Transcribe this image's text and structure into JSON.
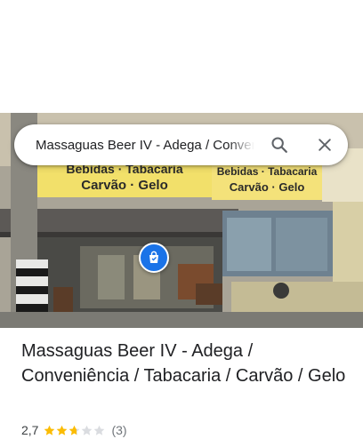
{
  "search": {
    "query": "Massaguas Beer IV - Adega / Conveniência / Tabacaria / Carvão / Gelo"
  },
  "photo": {
    "sign_left_line1": "Bebidas · Tabacaria",
    "sign_left_line2": "Carvão · Gelo",
    "sign_right_line1": "Bebidas · Tabacaria",
    "sign_right_line2": "Carvão · Gelo",
    "marker_icon": "shopping-bag-icon",
    "marker_color": "#1a73e8"
  },
  "place": {
    "title": "Massaguas Beer IV - Adega / Conveniência / Tabacaria / Carvão / Gelo",
    "rating": "2,7",
    "rating_stars": 2.7,
    "max_stars": 5,
    "reviews_count": "(3)",
    "star_color": "#fbbc04",
    "empty_star_color": "#dadce0"
  }
}
